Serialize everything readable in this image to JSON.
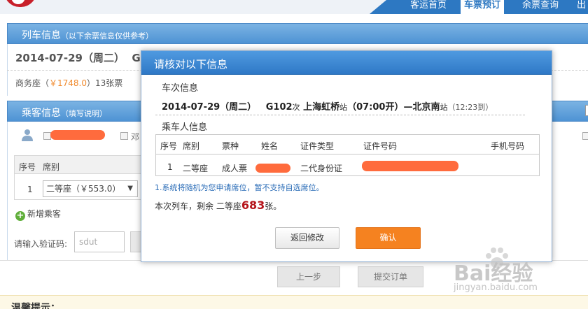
{
  "nav": {
    "items": [
      "客运首页",
      "车票预订",
      "余票查询",
      "出"
    ],
    "active_index": 1
  },
  "background": {
    "train_section": {
      "title": "列车信息",
      "subtitle": "（以下余票信息仅供参考）",
      "date": "2014-07-29（周二）",
      "date_suffix": "G",
      "seat_label": "商务座（",
      "seat_price": "￥1748.0",
      "seat_rest": "）13张票"
    },
    "passenger_section": {
      "title": "乘客信息",
      "subtitle": "（填写说明）",
      "checkbox_label": "邓",
      "table_headers": [
        "序号",
        "席别"
      ],
      "row_no": "1",
      "seat_select_value": "二等座（￥553.0）",
      "add_passenger": "新增乘客",
      "captcha_label": "请输入验证码:",
      "captcha_placeholder": "sdut"
    },
    "buttons": {
      "prev": "上一步",
      "submit": "提交订单"
    },
    "tips_title": "温馨提示："
  },
  "modal": {
    "title": "请核对以下信息",
    "train_info_title": "车次信息",
    "train": {
      "date": "2014-07-29（周二）",
      "number": "G102",
      "number_suffix": "次",
      "from": "上海虹桥",
      "station_suffix": "站",
      "depart": "（07:00开）—",
      "to": "北京南",
      "to_suffix": "站",
      "arrive": "（12:23到）"
    },
    "passenger_info_title": "乘车人信息",
    "table": {
      "headers": [
        "序号",
        "席别",
        "票种",
        "姓名",
        "证件类型",
        "证件号码",
        "手机号码"
      ],
      "row": {
        "no": "1",
        "seat": "二等座",
        "ticket_type": "成人票",
        "id_type": "二代身份证"
      }
    },
    "note_random_seat": "1.系统将随机为您申请席位，暂不支持自选席位。",
    "remain": {
      "prefix": "本次列车，剩余 二等座",
      "count": "683",
      "suffix": "张。"
    },
    "buttons": {
      "back": "返回修改",
      "confirm": "确认"
    }
  },
  "watermark": {
    "logo": "Bai经验",
    "url": "jingyan.baidu.com"
  },
  "colors": {
    "brand_blue": "#2d78c2",
    "confirm_orange": "#f58220",
    "count_red": "#b5141a",
    "redaction": "#ff6b3d"
  }
}
